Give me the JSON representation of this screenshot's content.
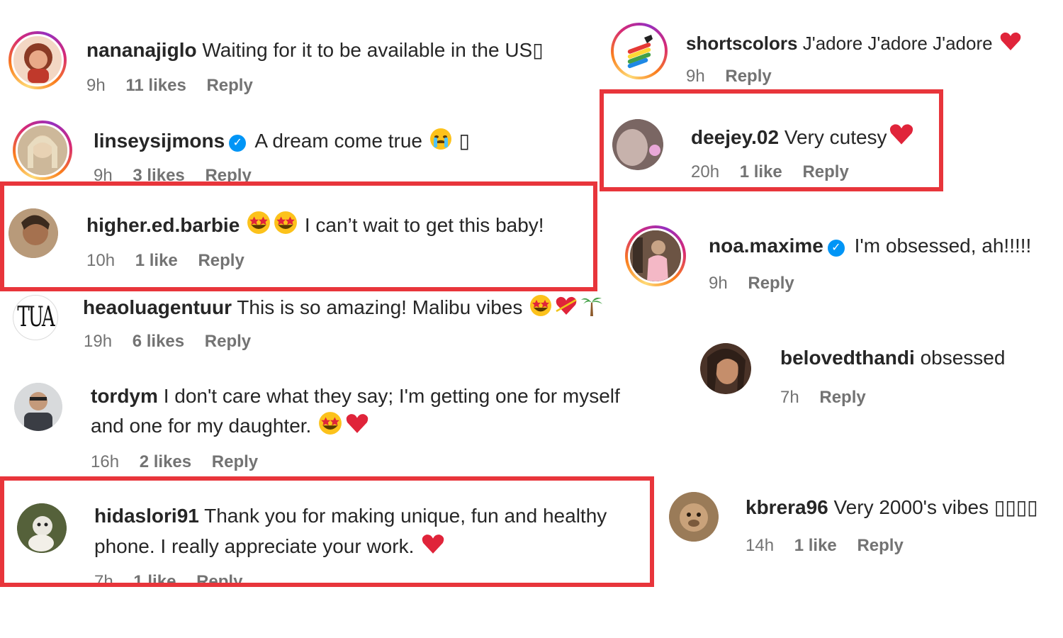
{
  "comments": [
    {
      "user": "nananajiglo",
      "text": "Waiting for it to be available in the US▯",
      "time": "9h",
      "likes": "11 likes",
      "reply": "Reply"
    },
    {
      "user": "linseysijmons",
      "text": "A dream come true",
      "tail": "▯",
      "time": "9h",
      "likes": "3 likes",
      "reply": "Reply"
    },
    {
      "user": "higher.ed.barbie",
      "text": "I can’t wait to get this baby!",
      "time": "10h",
      "likes": "1 like",
      "reply": "Reply"
    },
    {
      "user": "heaoluagentuur",
      "text": "This is so amazing! Malibu vibes",
      "time": "19h",
      "likes": "6 likes",
      "reply": "Reply"
    },
    {
      "user": "tordym",
      "text": "I don't care what they say; I'm getting one for myself",
      "text2": "and one for my daughter.",
      "time": "16h",
      "likes": "2 likes",
      "reply": "Reply"
    },
    {
      "user": "hidaslori91",
      "text": "Thank you for making unique, fun and healthy",
      "text2": "phone. I really appreciate your work.",
      "time": "7h",
      "likes": "1 like",
      "reply": "Reply"
    },
    {
      "user": "shortscolors",
      "text": "J'adore J'adore J'adore",
      "time": "9h",
      "reply": "Reply"
    },
    {
      "user": "deejey.02",
      "text": "Very cutesy",
      "time": "20h",
      "likes": "1 like",
      "reply": "Reply"
    },
    {
      "user": "noa.maxime",
      "text": "I'm obsessed, ah!!!!!",
      "time": "9h",
      "reply": "Reply"
    },
    {
      "user": "belovedthandi",
      "text": "obsessed",
      "time": "7h",
      "reply": "Reply"
    },
    {
      "user": "kbrera96",
      "text": "Very 2000's vibes ▯▯▯▯",
      "time": "14h",
      "likes": "1 like",
      "reply": "Reply"
    }
  ],
  "logo_text": "TUA",
  "colors": {
    "highlight": "#e8353b",
    "verified": "#0095f6",
    "heart": "#e0243a"
  }
}
